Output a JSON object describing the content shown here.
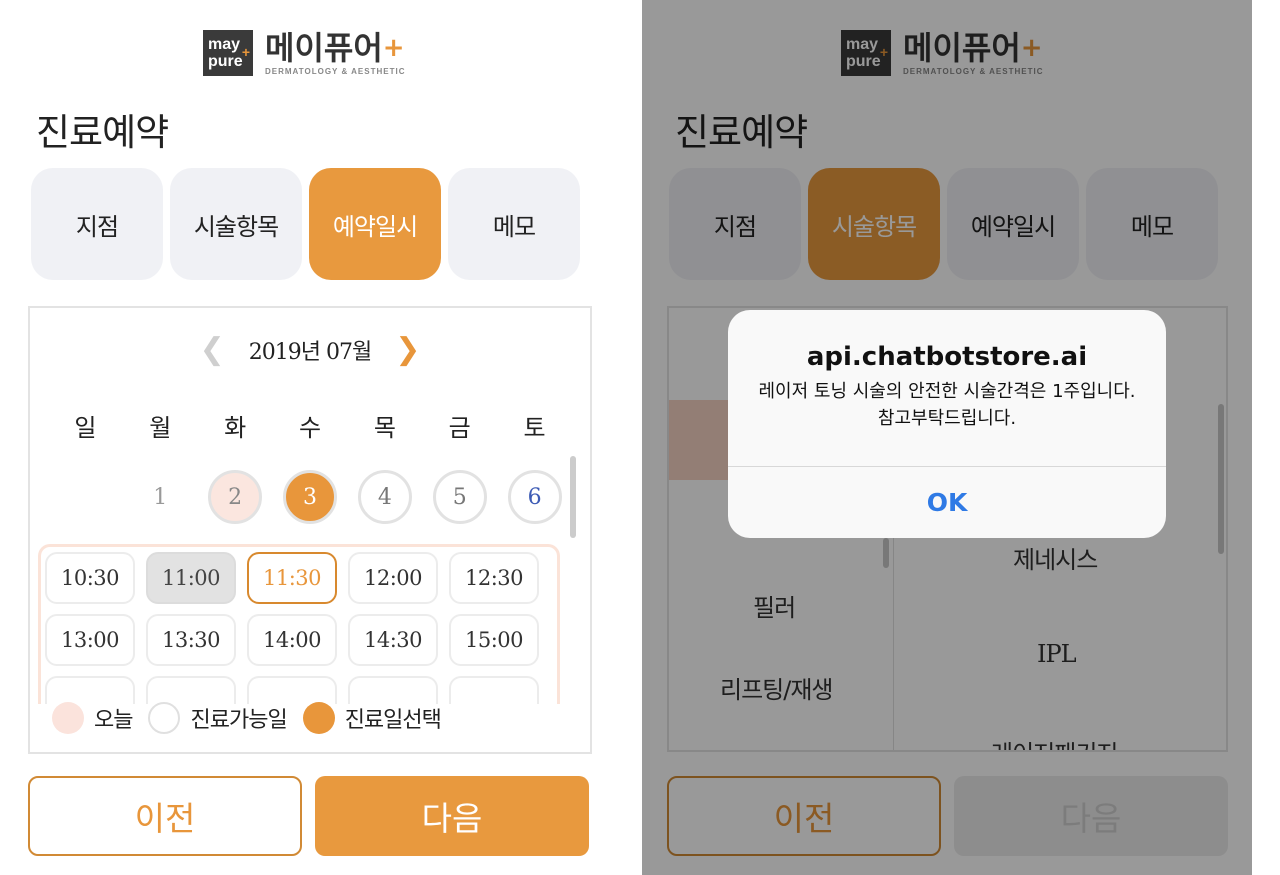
{
  "brand": {
    "box_line1": "may",
    "box_line2": "pure",
    "box_plus": "+",
    "name_kr": "메이퓨어",
    "name_plus": "+",
    "tagline": "DERMATOLOGY & AESTHETIC"
  },
  "page_title": "진료예약",
  "steps": [
    "지점",
    "시술항목",
    "예약일시",
    "메모"
  ],
  "left": {
    "active_step": 2,
    "calendar": {
      "month_label": "2019년 07월",
      "prev_icon": "chevron-left-icon",
      "next_icon": "chevron-right-icon",
      "weekdays": [
        "일",
        "월",
        "화",
        "수",
        "목",
        "금",
        "토"
      ],
      "days": [
        {
          "label": "",
          "state": "empty"
        },
        {
          "label": "1",
          "state": "none"
        },
        {
          "label": "2",
          "state": "today"
        },
        {
          "label": "3",
          "state": "selected"
        },
        {
          "label": "4",
          "state": "avail"
        },
        {
          "label": "5",
          "state": "avail"
        },
        {
          "label": "6",
          "state": "avail-sat"
        }
      ]
    },
    "times": [
      {
        "label": "10:30",
        "state": "normal"
      },
      {
        "label": "11:00",
        "state": "disabled"
      },
      {
        "label": "11:30",
        "state": "selected"
      },
      {
        "label": "12:00",
        "state": "normal"
      },
      {
        "label": "12:30",
        "state": "normal"
      },
      {
        "label": "13:00",
        "state": "normal"
      },
      {
        "label": "13:30",
        "state": "normal"
      },
      {
        "label": "14:00",
        "state": "normal"
      },
      {
        "label": "14:30",
        "state": "normal"
      },
      {
        "label": "15:00",
        "state": "normal"
      },
      {
        "label": "",
        "state": "normal"
      },
      {
        "label": "",
        "state": "normal"
      },
      {
        "label": "",
        "state": "normal"
      },
      {
        "label": "",
        "state": "normal"
      },
      {
        "label": "",
        "state": "normal"
      }
    ],
    "legend": {
      "today": "오늘",
      "available": "진료가능일",
      "selected": "진료일선택"
    },
    "buttons": {
      "prev": "이전",
      "next": "다음"
    }
  },
  "right": {
    "active_step": 1,
    "categories": [
      "필러",
      "리프팅/재생"
    ],
    "items": [
      "제네시스",
      "IPL",
      "레이저패키지"
    ],
    "dialog": {
      "title": "api.chatbotstore.ai",
      "message": "레이저 토닝 시술의 안전한 시술간격은 1주입니다. 참고부탁드립니다.",
      "ok": "OK"
    },
    "buttons": {
      "prev": "이전",
      "next": "다음"
    }
  },
  "colors": {
    "accent": "#e8993e",
    "today_bg": "#fbe6df",
    "saturday": "#3d5bb5",
    "ios_blue": "#2f7ae5"
  }
}
